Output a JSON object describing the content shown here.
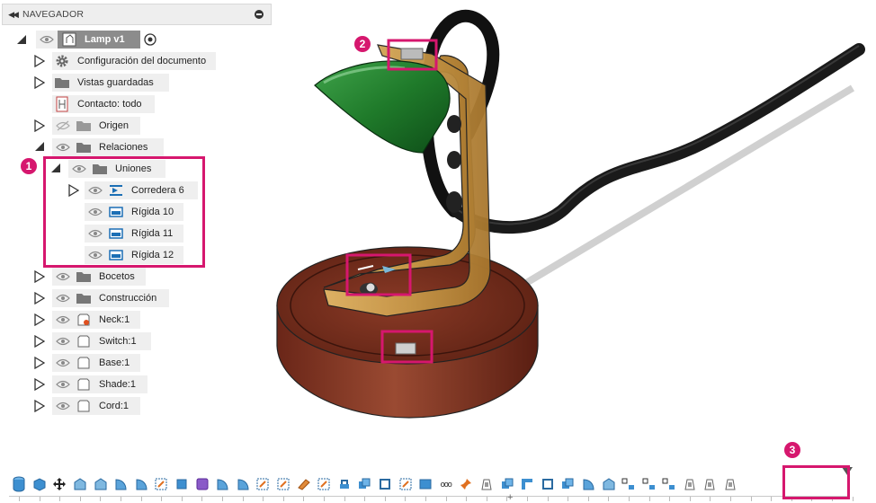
{
  "browser": {
    "title": "NAVEGADOR",
    "root": "Lamp v1",
    "items": [
      {
        "label": "Configuración del documento"
      },
      {
        "label": "Vistas guardadas"
      },
      {
        "label": "Contacto: todo"
      },
      {
        "label": "Origen"
      },
      {
        "label": "Relaciones"
      },
      {
        "label": "Uniones"
      },
      {
        "label": "Corredera 6"
      },
      {
        "label": "Rígida 10"
      },
      {
        "label": "Rígida 11"
      },
      {
        "label": "Rígida 12"
      },
      {
        "label": "Bocetos"
      },
      {
        "label": "Construcción"
      },
      {
        "label": "Neck:1"
      },
      {
        "label": "Switch:1"
      },
      {
        "label": "Base:1"
      },
      {
        "label": "Shade:1"
      },
      {
        "label": "Cord:1"
      }
    ]
  },
  "callouts": {
    "one": "1",
    "two": "2",
    "three": "3"
  },
  "toolbar": {
    "ellipsis": "ooo",
    "plus": "+"
  },
  "colors": {
    "highlight": "#d6176e",
    "wood": "#7a2f22",
    "brass": "#c99a4a",
    "shade_green": "#1f7a2a",
    "cord": "#1a1a1a"
  }
}
